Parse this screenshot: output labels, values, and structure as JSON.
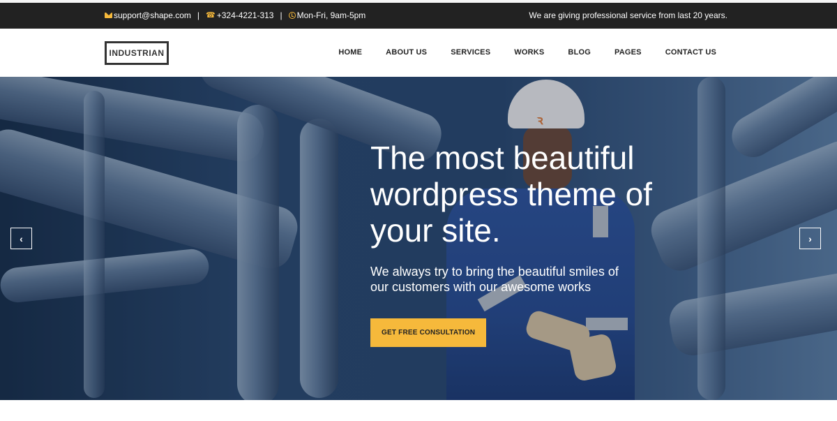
{
  "topbar": {
    "email": "support@shape.com",
    "phone": "+324-4221-313",
    "hours": "Mon-Fri, 9am-5pm",
    "separator": "|",
    "tagline": "We are giving professional service from last 20 years."
  },
  "header": {
    "logo": "INDUSTRIAN",
    "nav": [
      "HOME",
      "ABOUT US",
      "SERVICES",
      "WORKS",
      "BLOG",
      "PAGES",
      "CONTACT US"
    ]
  },
  "hero": {
    "title": "The most beautiful wordpress theme of your site.",
    "subtitle": "We always try to bring the beautiful smiles of our customers with our awesome works",
    "cta": "GET FREE CONSULTATION",
    "prev": "‹",
    "next": "›"
  },
  "icons": {
    "email": "envelope-icon",
    "phone": "phone-icon",
    "hours": "clock-icon"
  },
  "colors": {
    "accent": "#f6b93b",
    "topbar_bg": "#222222",
    "hero_text": "#ffffff"
  }
}
